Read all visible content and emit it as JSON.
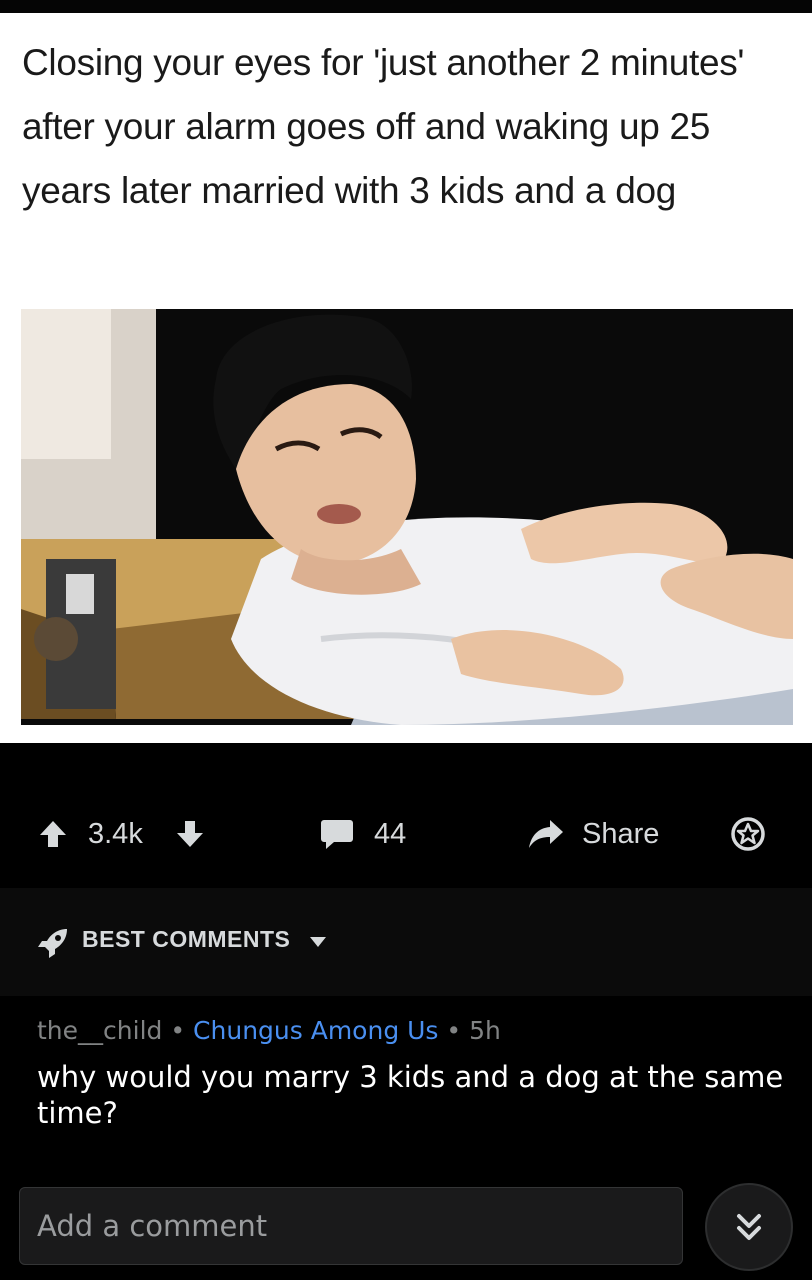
{
  "meme": {
    "caption": "Closing your eyes for 'just another 2 minutes' after your alarm goes off and waking up 25 years later married with 3 kids and a dog"
  },
  "post_actions": {
    "upvote_icon": "arrow-up-icon",
    "score": "3.4k",
    "downvote_icon": "arrow-down-icon",
    "comment_icon": "speech-bubble-icon",
    "comment_count": "44",
    "share_icon": "share-arrow-icon",
    "share_label": "Share",
    "award_icon": "star-badge-icon"
  },
  "sort": {
    "icon": "rocket-icon",
    "label": "BEST COMMENTS",
    "caret_icon": "caret-down-icon"
  },
  "comment": {
    "author": "the__child",
    "separator": "•",
    "flair": "Chungus Among Us",
    "age": "5h",
    "body": "why would you marry 3 kids and a dog at the same time?"
  },
  "composer": {
    "placeholder": "Add a comment",
    "jump_icon": "double-chevron-down-icon"
  },
  "colors": {
    "background": "#000000",
    "text": "#d7dadc",
    "flair": "#4a8ff0",
    "meta": "#818384"
  }
}
